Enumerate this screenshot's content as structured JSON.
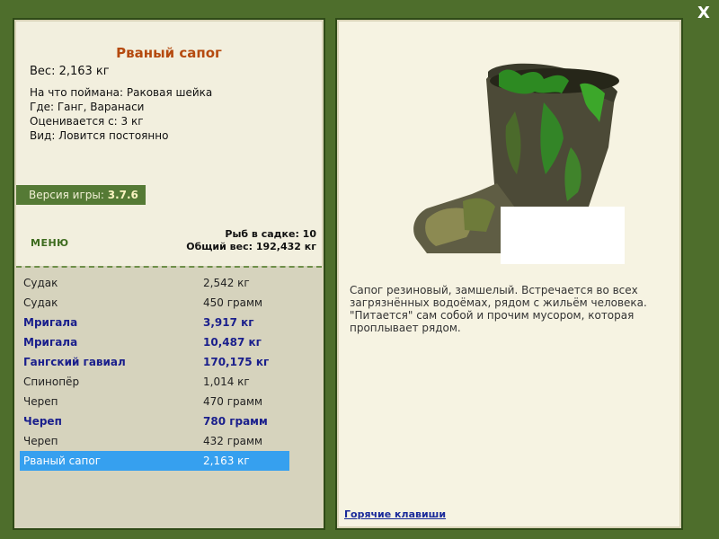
{
  "close_label": "X",
  "fish": {
    "title": "Рваный сапог",
    "weight": "Вес: 2,163 кг",
    "caught_on": "На что поймана: Раковая шейка",
    "location": "Где: Ганг, Варанаси",
    "valued_from": "Оценивается с: 3 кг",
    "kind": "Вид: Ловится постоянно",
    "description": "Сапог резиновый, замшелый. Встречается во всех загрязнённых водоёмах, рядом с жильём человека. \"Питается\" сам собой и прочим мусором, которая проплывает рядом."
  },
  "version": {
    "label": "Версия игры:",
    "value": "3.7.6"
  },
  "menu_label": "МЕНЮ",
  "keepnet": {
    "count_label": "Рыб в садке: 10",
    "total_label": "Общий вес: 192,432 кг",
    "rows": [
      {
        "name": "Судак",
        "weight": "2,542 кг",
        "bold": false
      },
      {
        "name": "Судак",
        "weight": "450 грамм",
        "bold": false
      },
      {
        "name": "Мригала",
        "weight": "3,917 кг",
        "bold": true
      },
      {
        "name": "Мригала",
        "weight": "10,487 кг",
        "bold": true
      },
      {
        "name": "Гангский гавиал",
        "weight": "170,175 кг",
        "bold": true
      },
      {
        "name": "Спинопёр",
        "weight": "1,014 кг",
        "bold": false
      },
      {
        "name": "Череп",
        "weight": "470 грамм",
        "bold": false
      },
      {
        "name": "Череп",
        "weight": "780 грамм",
        "bold": true
      },
      {
        "name": "Череп",
        "weight": "432 грамм",
        "bold": false
      },
      {
        "name": "Рваный сапог",
        "weight": "2,163 кг",
        "bold": false,
        "selected": true
      }
    ]
  },
  "hotkeys_label": "Горячие клавиши",
  "colors": {
    "frame": "#4e6e2c",
    "title": "#b54a0f",
    "selected_row": "#36a0ef",
    "rare_fish": "#1a1f8c"
  }
}
